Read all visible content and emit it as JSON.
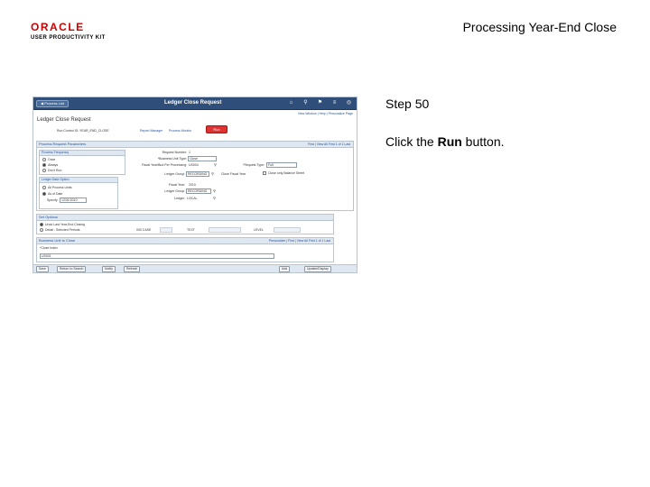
{
  "logo": {
    "brand": "ORACLE",
    "subtitle": "USER PRODUCTIVITY KIT"
  },
  "doc_title": "Processing Year-End Close",
  "step": "Step 50",
  "instruction": {
    "prefix": "Click the ",
    "target": "Run",
    "suffix": " button."
  },
  "screenshot": {
    "process_list_label": "Process List",
    "window_title": "Ledger Close Request",
    "links": "New Window | Help | Personalize Page",
    "page_heading": "Ledger Close Request",
    "run_control": "Run Control ID: YEAR_END_CLOSE",
    "report_manager": "Report Manager",
    "process_monitor": "Process Monitor",
    "run_label": "Run",
    "section1": {
      "title": "Process Request Parameters",
      "nav": "Find | View All   First 1 of 1 Last",
      "frequency_title": "Process Frequency",
      "freq_once": "Once",
      "freq_always": "Always",
      "freq_dont_run": "Don't Run",
      "request_number_label": "Request Number:",
      "request_number": "1",
      "business_unit_label": "*Business Unit Type:",
      "business_unit": "Close",
      "fiscal_year_label": "Fiscal Year/Bud Per Processing:",
      "fiscal_year": "US004",
      "request_type_label": "*Request Type:",
      "request_type": "Full",
      "ledger_group_label": "Ledger Group:",
      "ledger_group": "RECORDING",
      "close_fy_label": "Close Fiscal Year",
      "close_only_label": "Close only Balance Sheet",
      "fiscal_year2_label": "Fiscal Year:",
      "fiscal_year2": "2010",
      "ledger_group2_label": "Ledger Group:",
      "ledger_group2": "RECORDING",
      "ledger_label": "Ledger:",
      "ledger": "LOCAL",
      "ledger_date_title": "Ledger Date Option",
      "all_process_label": "All Process Units",
      "as_of_label": "As of Date",
      "specify_label": "Specify:",
      "specify_value": "12/31/2010"
    },
    "section2": {
      "title": "Set Options",
      "opt1": "Undo Last Year-End Closing",
      "opt2": "Detail - Selected Periods",
      "from_label": "000 CASE",
      "from_field": "",
      "to_label": "TEXT",
      "level_label": "LEVEL"
    },
    "section3": {
      "title": "Business Unit to Close",
      "nav": "Personalize | Find | View All   First 1 of 1 Last",
      "col_header": "*Close Index",
      "row_value": "US001"
    },
    "bottom": {
      "save": "Save",
      "return": "Return to Search",
      "notify": "Notify",
      "refresh": "Refresh",
      "add": "Add",
      "update": "Update/Display"
    }
  }
}
